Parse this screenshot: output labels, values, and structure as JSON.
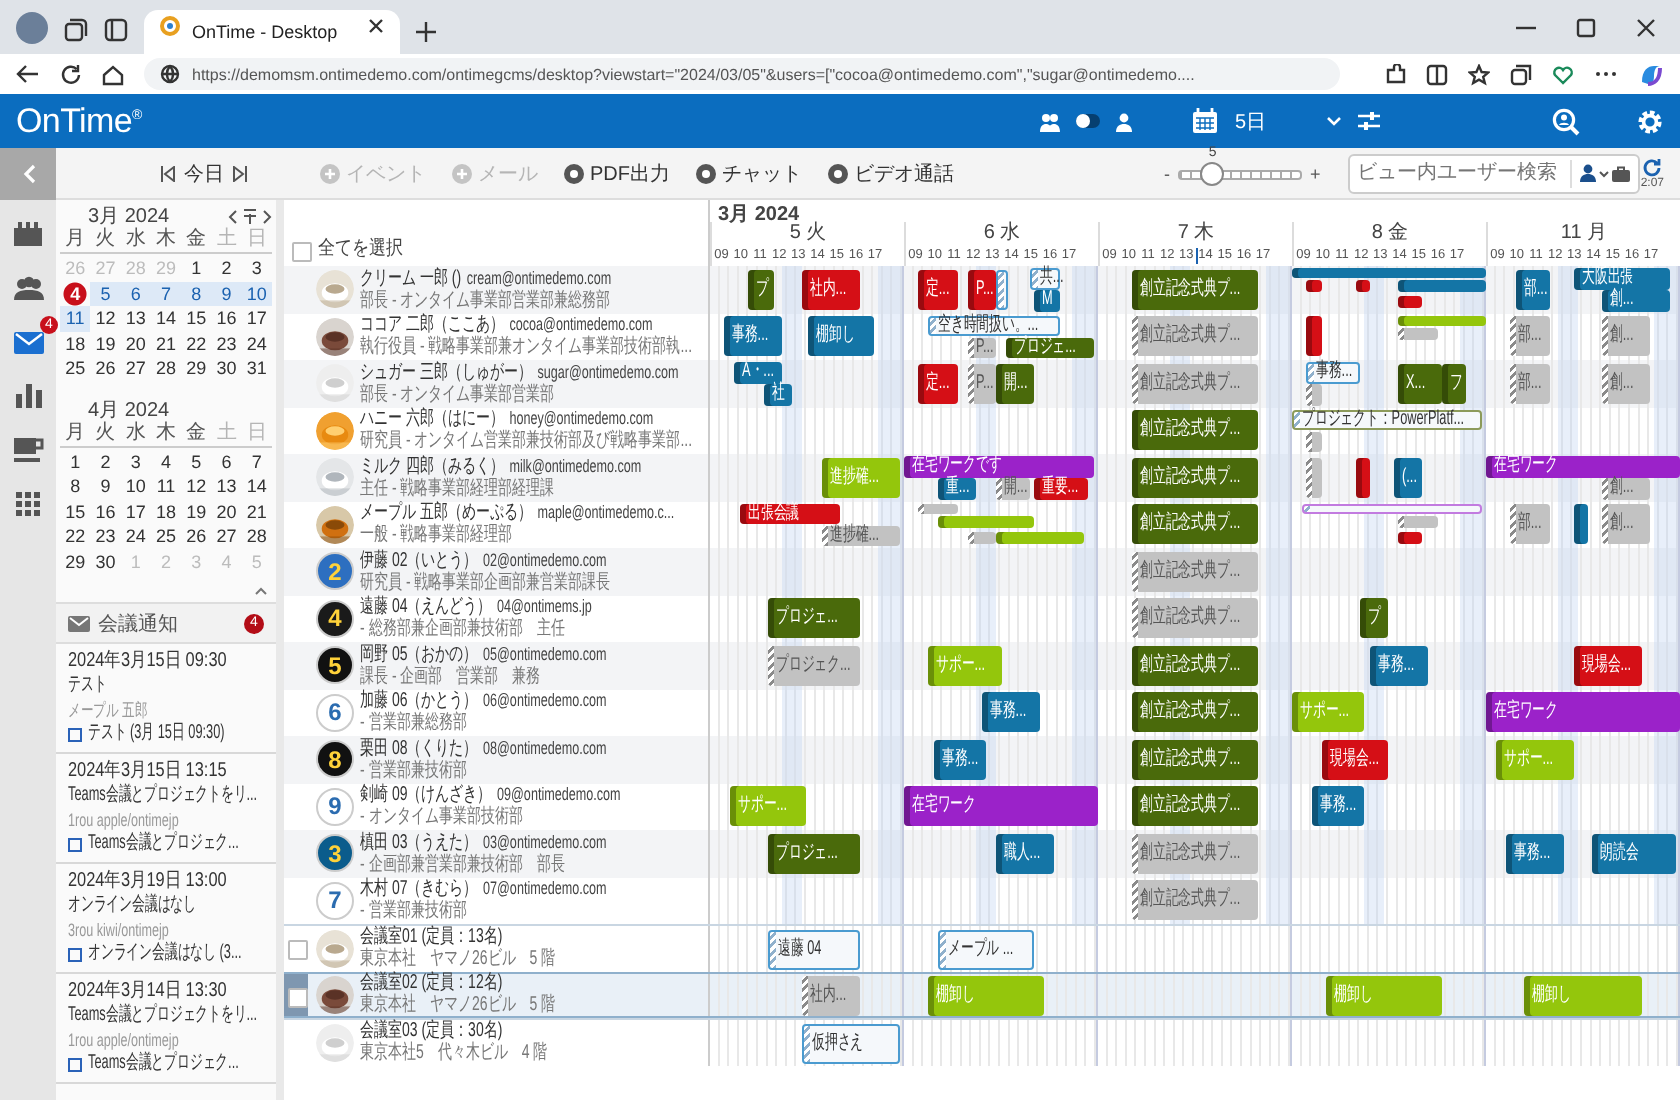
{
  "browser": {
    "tab_title": "OnTime - Desktop",
    "url": "https://demomsm.ontimedemo.com/ontimegcms/desktop?viewstart=\"2024/03/05\"&users=[\"cocoa@ontimedemo.com\",\"sugar@ontimedemo...."
  },
  "app": {
    "logo": "OnTime$^{®}$",
    "team_toggle": {
      "on": false
    },
    "days": "5日"
  },
  "toolbar": {
    "today": "今日",
    "actions": [
      {
        "label": "イベント",
        "kind": "plus",
        "disabled": true
      },
      {
        "label": "メール",
        "kind": "plus",
        "disabled": true
      },
      {
        "label": "PDF出力",
        "kind": "dot",
        "disabled": false
      },
      {
        "label": "チャット",
        "kind": "dot",
        "disabled": false
      },
      {
        "label": "ビデオ通話",
        "kind": "dot",
        "disabled": false
      }
    ],
    "zoom": {
      "value": "5",
      "minus": "-",
      "plus": "+",
      "level": 0.28
    },
    "search": {
      "placeholder": "ビュー内ユーザー検索"
    },
    "refresh_time": "2:07"
  },
  "rail": [
    {
      "kind": "calendar",
      "selected": false
    },
    {
      "kind": "people",
      "selected": false
    },
    {
      "kind": "mail",
      "selected": true,
      "badge": "4"
    },
    {
      "kind": "chart",
      "selected": false
    },
    {
      "kind": "cup",
      "selected": false
    },
    {
      "kind": "grid",
      "selected": false
    }
  ],
  "mini_calendars": [
    {
      "title": "3月 2024",
      "weekdays": [
        {
          "label": "月",
          "weekend": false
        },
        {
          "label": "火",
          "weekend": false
        },
        {
          "label": "水",
          "weekend": false
        },
        {
          "label": "木",
          "weekend": false
        },
        {
          "label": "金",
          "weekend": false
        },
        {
          "label": "土",
          "weekend": true
        },
        {
          "label": "日",
          "weekend": true
        }
      ],
      "days": [
        {
          "day": "26",
          "muted": true,
          "today": false,
          "selected": false
        },
        {
          "day": "27",
          "muted": true,
          "today": false,
          "selected": false
        },
        {
          "day": "28",
          "muted": true,
          "today": false,
          "selected": false
        },
        {
          "day": "29",
          "muted": true,
          "today": false,
          "selected": false
        },
        {
          "day": "1",
          "muted": false,
          "today": false,
          "selected": false
        },
        {
          "day": "2",
          "muted": false,
          "today": false,
          "selected": false
        },
        {
          "day": "3",
          "muted": false,
          "today": false,
          "selected": false
        },
        {
          "day": "4",
          "muted": false,
          "today": true,
          "selected": false
        },
        {
          "day": "5",
          "muted": false,
          "today": false,
          "selected": true
        },
        {
          "day": "6",
          "muted": false,
          "today": false,
          "selected": true
        },
        {
          "day": "7",
          "muted": false,
          "today": false,
          "selected": true
        },
        {
          "day": "8",
          "muted": false,
          "today": false,
          "selected": true
        },
        {
          "day": "9",
          "muted": false,
          "today": false,
          "selected": true
        },
        {
          "day": "10",
          "muted": false,
          "today": false,
          "selected": true
        },
        {
          "day": "11",
          "muted": false,
          "today": false,
          "selected": true
        },
        {
          "day": "12",
          "muted": false,
          "today": false,
          "selected": false
        },
        {
          "day": "13",
          "muted": false,
          "today": false,
          "selected": false
        },
        {
          "day": "14",
          "muted": false,
          "today": false,
          "selected": false
        },
        {
          "day": "15",
          "muted": false,
          "today": false,
          "selected": false
        },
        {
          "day": "16",
          "muted": false,
          "today": false,
          "selected": false
        },
        {
          "day": "17",
          "muted": false,
          "today": false,
          "selected": false
        },
        {
          "day": "18",
          "muted": false,
          "today": false,
          "selected": false
        },
        {
          "day": "19",
          "muted": false,
          "today": false,
          "selected": false
        },
        {
          "day": "20",
          "muted": false,
          "today": false,
          "selected": false
        },
        {
          "day": "21",
          "muted": false,
          "today": false,
          "selected": false
        },
        {
          "day": "22",
          "muted": false,
          "today": false,
          "selected": false
        },
        {
          "day": "23",
          "muted": false,
          "today": false,
          "selected": false
        },
        {
          "day": "24",
          "muted": false,
          "today": false,
          "selected": false
        },
        {
          "day": "25",
          "muted": false,
          "today": false,
          "selected": false
        },
        {
          "day": "26",
          "muted": false,
          "today": false,
          "selected": false
        },
        {
          "day": "27",
          "muted": false,
          "today": false,
          "selected": false
        },
        {
          "day": "28",
          "muted": false,
          "today": false,
          "selected": false
        },
        {
          "day": "29",
          "muted": false,
          "today": false,
          "selected": false
        },
        {
          "day": "30",
          "muted": false,
          "today": false,
          "selected": false
        },
        {
          "day": "31",
          "muted": false,
          "today": false,
          "selected": false
        }
      ]
    },
    {
      "title": "4月 2024",
      "weekdays": [
        {
          "label": "月",
          "weekend": false
        },
        {
          "label": "火",
          "weekend": false
        },
        {
          "label": "水",
          "weekend": false
        },
        {
          "label": "木",
          "weekend": false
        },
        {
          "label": "金",
          "weekend": false
        },
        {
          "label": "土",
          "weekend": true
        },
        {
          "label": "日",
          "weekend": true
        }
      ],
      "days": [
        {
          "day": "1",
          "muted": false,
          "today": false,
          "selected": false
        },
        {
          "day": "2",
          "muted": false,
          "today": false,
          "selected": false
        },
        {
          "day": "3",
          "muted": false,
          "today": false,
          "selected": false
        },
        {
          "day": "4",
          "muted": false,
          "today": false,
          "selected": false
        },
        {
          "day": "5",
          "muted": false,
          "today": false,
          "selected": false
        },
        {
          "day": "6",
          "muted": false,
          "today": false,
          "selected": false
        },
        {
          "day": "7",
          "muted": false,
          "today": false,
          "selected": false
        },
        {
          "day": "8",
          "muted": false,
          "today": false,
          "selected": false
        },
        {
          "day": "9",
          "muted": false,
          "today": false,
          "selected": false
        },
        {
          "day": "10",
          "muted": false,
          "today": false,
          "selected": false
        },
        {
          "day": "11",
          "muted": false,
          "today": false,
          "selected": false
        },
        {
          "day": "12",
          "muted": false,
          "today": false,
          "selected": false
        },
        {
          "day": "13",
          "muted": false,
          "today": false,
          "selected": false
        },
        {
          "day": "14",
          "muted": false,
          "today": false,
          "selected": false
        },
        {
          "day": "15",
          "muted": false,
          "today": false,
          "selected": false
        },
        {
          "day": "16",
          "muted": false,
          "today": false,
          "selected": false
        },
        {
          "day": "17",
          "muted": false,
          "today": false,
          "selected": false
        },
        {
          "day": "18",
          "muted": false,
          "today": false,
          "selected": false
        },
        {
          "day": "19",
          "muted": false,
          "today": false,
          "selected": false
        },
        {
          "day": "20",
          "muted": false,
          "today": false,
          "selected": false
        },
        {
          "day": "21",
          "muted": false,
          "today": false,
          "selected": false
        },
        {
          "day": "22",
          "muted": false,
          "today": false,
          "selected": false
        },
        {
          "day": "23",
          "muted": false,
          "today": false,
          "selected": false
        },
        {
          "day": "24",
          "muted": false,
          "today": false,
          "selected": false
        },
        {
          "day": "25",
          "muted": false,
          "today": false,
          "selected": false
        },
        {
          "day": "26",
          "muted": false,
          "today": false,
          "selected": false
        },
        {
          "day": "27",
          "muted": false,
          "today": false,
          "selected": false
        },
        {
          "day": "28",
          "muted": false,
          "today": false,
          "selected": false
        },
        {
          "day": "29",
          "muted": false,
          "today": false,
          "selected": false
        },
        {
          "day": "30",
          "muted": false,
          "today": false,
          "selected": false
        },
        {
          "day": "1",
          "muted": true,
          "today": false,
          "selected": false
        },
        {
          "day": "2",
          "muted": true,
          "today": false,
          "selected": false
        },
        {
          "day": "3",
          "muted": true,
          "today": false,
          "selected": false
        },
        {
          "day": "4",
          "muted": true,
          "today": false,
          "selected": false
        },
        {
          "day": "5",
          "muted": true,
          "today": false,
          "selected": false
        }
      ]
    }
  ],
  "notifications": {
    "title": "会議通知",
    "count": "4",
    "items": [
      {
        "when": "2024年3月15日 09:30",
        "subject": "テスト",
        "from": "メープル 五郎",
        "link": "テスト (3月 15日 09:30)"
      },
      {
        "when": "2024年3月15日 13:15",
        "subject": "Teams会議とプロジェクトをリ...",
        "from": "1rou apple/ontimejp",
        "link": "Teams会議とプロジェク..."
      },
      {
        "when": "2024年3月19日 13:00",
        "subject": "オンライン会議はなし",
        "from": "3rou kiwi/ontimejp",
        "link": "オンライン会議はなし (3..."
      },
      {
        "when": "2024年3月14日 13:30",
        "subject": "Teams会議とプロジェクトをリ...",
        "from": "1rou apple/ontimejp",
        "link": "Teams会議とプロジェク..."
      }
    ]
  },
  "users": {
    "select_all": "全てを選択",
    "select_all_checked": false
  },
  "timeline": {
    "month": "3月 2024",
    "days": [
      {
        "label": "5 火",
        "hours": [
          "09",
          "10",
          "11",
          "12",
          "13",
          "14",
          "15",
          "16",
          "17"
        ]
      },
      {
        "label": "6 水",
        "hours": [
          "09",
          "10",
          "11",
          "12",
          "13",
          "14",
          "15",
          "16",
          "17"
        ]
      },
      {
        "label": "7 木",
        "hours": [
          "09",
          "10",
          "11",
          "12",
          "13",
          "14",
          "15",
          "16",
          "17"
        ]
      },
      {
        "label": "8 金",
        "hours": [
          "09",
          "10",
          "11",
          "12",
          "13",
          "14",
          "15",
          "16",
          "17"
        ]
      },
      {
        "label": "11 月",
        "hours": [
          "09",
          "10",
          "11",
          "12",
          "13",
          "14",
          "15",
          "16",
          "17"
        ]
      }
    ]
  },
  "rows": [
    {
      "kind": "user",
      "selected": false,
      "name": "クリーム 一郎 ()",
      "email": "cream@ontimedemo.com",
      "title": "部長 - オンタイム事業部営業部兼総務部",
      "avatar": {
        "kind": "picture"
      },
      "events": [
        {
          "label": "プ",
          "kind": "solid",
          "color": "#4a6a0b"
        },
        {
          "label": "社内...",
          "kind": "solid",
          "color": "#d50f16"
        },
        {
          "label": "定...",
          "kind": "solid",
          "color": "#d50f16"
        },
        {
          "label": "P...",
          "kind": "solid",
          "color": "#d50f16"
        },
        {
          "kind": "outline",
          "color": "#4a9bd0"
        },
        {
          "label": "共...",
          "kind": "outline",
          "color": "#4a9bd0"
        },
        {
          "label": "M",
          "kind": "solid",
          "color": "#1475a6"
        },
        {
          "label": "創立記念式典プ...",
          "kind": "solid",
          "color": "#4a6a0b"
        },
        {
          "kind": "solid",
          "color": "#1475a6"
        },
        {
          "kind": "solid",
          "color": "#d50f16"
        },
        {
          "kind": "solid",
          "color": "#d50f16"
        },
        {
          "kind": "solid",
          "color": "#1475a6"
        },
        {
          "kind": "solid",
          "color": "#d50f16"
        },
        {
          "label": "部...",
          "kind": "solid",
          "color": "#1475a6"
        },
        {
          "label": "大阪出張",
          "kind": "solid",
          "color": "#1475a6"
        },
        {
          "label": "創...",
          "kind": "solid",
          "color": "#1475a6"
        }
      ]
    },
    {
      "kind": "user",
      "selected": false,
      "name": "ココア 二郎（ここあ）",
      "email": "cocoa@ontimedemo.com",
      "title": "執行役員 - 戦略事業部兼オンタイム事業部技術部執...",
      "avatar": {
        "kind": "picture"
      },
      "events": [
        {
          "label": "事務...",
          "kind": "solid",
          "color": "#1475a6"
        },
        {
          "label": "棚卸し",
          "kind": "solid",
          "color": "#1475a6"
        },
        {
          "label": "空き時間扱い。...",
          "kind": "outline",
          "color": "#4a9bd0"
        },
        {
          "label": "P...",
          "kind": "tentative",
          "color": "#c2c2c2"
        },
        {
          "label": "プロジェ...",
          "kind": "solid",
          "color": "#4a6a0b"
        },
        {
          "label": "創立記念式典プ...",
          "kind": "tentative",
          "color": "#c2c2c2"
        },
        {
          "kind": "solid",
          "color": "#d50f16"
        },
        {
          "kind": "solid",
          "color": "#94c60c"
        },
        {
          "kind": "tentative",
          "color": "#c2c2c2"
        },
        {
          "label": "部...",
          "kind": "tentative",
          "color": "#c2c2c2"
        },
        {
          "label": "創...",
          "kind": "tentative",
          "color": "#c2c2c2"
        }
      ]
    },
    {
      "kind": "user",
      "selected": false,
      "name": "シュガー 三郎（しゅがー）",
      "email": "sugar@ontimedemo.com",
      "title": "部長 - オンタイム事業部営業部",
      "avatar": {
        "kind": "picture"
      },
      "events": [
        {
          "label": "A・...",
          "kind": "solid",
          "color": "#1475a6"
        },
        {
          "label": "社",
          "kind": "solid",
          "color": "#1475a6"
        },
        {
          "label": "定...",
          "kind": "solid",
          "color": "#d50f16"
        },
        {
          "label": "P...",
          "kind": "tentative",
          "color": "#c2c2c2"
        },
        {
          "label": "開...",
          "kind": "solid",
          "color": "#4a6a0b"
        },
        {
          "label": "創立記念式典プ...",
          "kind": "tentative",
          "color": "#c2c2c2"
        },
        {
          "label": "事務...",
          "kind": "outline",
          "color": "#4a9bd0"
        },
        {
          "kind": "tentative",
          "color": "#c2c2c2"
        },
        {
          "label": "X...",
          "kind": "solid",
          "color": "#4a6a0b"
        },
        {
          "label": "フ",
          "kind": "solid",
          "color": "#4a6a0b"
        },
        {
          "label": "部...",
          "kind": "tentative",
          "color": "#c2c2c2"
        },
        {
          "label": "創...",
          "kind": "tentative",
          "color": "#c2c2c2"
        }
      ]
    },
    {
      "kind": "user",
      "selected": false,
      "name": "ハニー 六郎（はにー）",
      "email": "honey@ontimedemo.com",
      "title": "研究員 - オンタイム営業部兼技術部及び戦略事業部...",
      "avatar": {
        "kind": "picture"
      },
      "events": [
        {
          "label": "創立記念式典プ...",
          "kind": "solid",
          "color": "#4a6a0b"
        },
        {
          "label": "プロジェクト：PowerPlatf...",
          "kind": "outline",
          "color": "#8c9a5a"
        },
        {
          "kind": "tentative",
          "color": "#c2c2c2"
        }
      ]
    },
    {
      "kind": "user",
      "selected": false,
      "name": "ミルク 四郎（みるく）",
      "email": "milk@ontimedemo.com",
      "title": "主任 - 戦略事業部経理部経理課",
      "avatar": {
        "kind": "picture"
      },
      "events": [
        {
          "label": "進捗確...",
          "kind": "solid",
          "color": "#94c60c"
        },
        {
          "label": "在宅ワークです",
          "kind": "solid",
          "color": "#9b22c9"
        },
        {
          "label": "重...",
          "kind": "solid",
          "color": "#1475a6"
        },
        {
          "label": "開...",
          "kind": "tentative",
          "color": "#c2c2c2"
        },
        {
          "label": "重要...",
          "kind": "solid",
          "color": "#d50f16"
        },
        {
          "label": "創立記念式典プ...",
          "kind": "solid",
          "color": "#4a6a0b"
        },
        {
          "kind": "tentative",
          "color": "#c2c2c2"
        },
        {
          "kind": "solid",
          "color": "#d50f16"
        },
        {
          "label": "(...",
          "kind": "solid",
          "color": "#1475a6"
        },
        {
          "label": "在宅ワーク",
          "kind": "solid",
          "color": "#9b22c9"
        },
        {
          "label": "創...",
          "kind": "tentative",
          "color": "#c2c2c2"
        }
      ]
    },
    {
      "kind": "user",
      "selected": false,
      "name": "メープル 五郎（めーぷる）",
      "email": "maple@ontimedemo.c...",
      "title": "一般 - 戦略事業部経理部",
      "avatar": {
        "kind": "picture"
      },
      "events": [
        {
          "label": "出張会議",
          "kind": "solid",
          "color": "#d50f16"
        },
        {
          "label": "進捗確...",
          "kind": "tentative",
          "color": "#c2c2c2"
        },
        {
          "kind": "tentative",
          "color": "#c2c2c2"
        },
        {
          "kind": "solid",
          "color": "#94c60c"
        },
        {
          "kind": "tentative",
          "color": "#c2c2c2"
        },
        {
          "kind": "solid",
          "color": "#94c60c"
        },
        {
          "label": "創立記念式典プ...",
          "kind": "solid",
          "color": "#4a6a0b"
        },
        {
          "kind": "outline",
          "color": "#c27be0"
        },
        {
          "kind": "tentative",
          "color": "#c2c2c2"
        },
        {
          "kind": "solid",
          "color": "#d50f16"
        },
        {
          "label": "部...",
          "kind": "tentative",
          "color": "#c2c2c2"
        },
        {
          "kind": "solid",
          "color": "#1475a6"
        },
        {
          "label": "創...",
          "kind": "tentative",
          "color": "#c2c2c2"
        }
      ]
    },
    {
      "kind": "user",
      "selected": false,
      "name": "伊藤 02（いとう）",
      "email": "02@ontimedemo.com",
      "title": "研究員 - 戦略事業部企画部兼営業部課長",
      "avatar": {
        "kind": "number",
        "text": "2",
        "color": "#2d6fc0"
      },
      "events": [
        {
          "label": "創立記念式典プ...",
          "kind": "tentative",
          "color": "#c2c2c2"
        }
      ]
    },
    {
      "kind": "user",
      "selected": false,
      "name": "遠藤 04（えんどう）",
      "email": "04@ontimems.jp",
      "title": "- 総務部兼企画部兼技術部　主任",
      "avatar": {
        "kind": "number",
        "text": "4",
        "color": "#1a1a1a"
      },
      "events": [
        {
          "label": "プロジェ...",
          "kind": "solid",
          "color": "#4a6a0b"
        },
        {
          "label": "創立記念式典プ...",
          "kind": "tentative",
          "color": "#c2c2c2"
        },
        {
          "label": "プ",
          "kind": "solid",
          "color": "#4a6a0b"
        }
      ]
    },
    {
      "kind": "user",
      "selected": false,
      "name": "岡野 05（おかの）",
      "email": "05@ontimedemo.com",
      "title": "課長 - 企画部　営業部　兼務",
      "avatar": {
        "kind": "number",
        "text": "5",
        "color": "#111111"
      },
      "events": [
        {
          "label": "プロジェク...",
          "kind": "tentative",
          "color": "#c2c2c2"
        },
        {
          "label": "サポー...",
          "kind": "solid",
          "color": "#94c60c"
        },
        {
          "label": "創立記念式典プ...",
          "kind": "solid",
          "color": "#4a6a0b"
        },
        {
          "label": "事務...",
          "kind": "solid",
          "color": "#1475a6"
        },
        {
          "label": "現場会...",
          "kind": "solid",
          "color": "#d50f16"
        }
      ]
    },
    {
      "kind": "user",
      "selected": false,
      "name": "加藤 06（かとう）",
      "email": "06@ontimedemo.com",
      "title": "- 営業部兼総務部",
      "avatar": {
        "kind": "number",
        "text": "6",
        "color": "#ffffff"
      },
      "events": [
        {
          "label": "事務...",
          "kind": "solid",
          "color": "#1475a6"
        },
        {
          "label": "創立記念式典プ...",
          "kind": "solid",
          "color": "#4a6a0b"
        },
        {
          "label": "サポー...",
          "kind": "solid",
          "color": "#94c60c"
        },
        {
          "label": "在宅ワーク",
          "kind": "solid",
          "color": "#9b22c9"
        }
      ]
    },
    {
      "kind": "user",
      "selected": false,
      "name": "栗田 08（くりた）",
      "email": "08@ontimedemo.com",
      "title": "- 営業部兼技術部",
      "avatar": {
        "kind": "number",
        "text": "8",
        "color": "#111111"
      },
      "events": [
        {
          "label": "事務...",
          "kind": "solid",
          "color": "#1475a6"
        },
        {
          "label": "創立記念式典プ...",
          "kind": "solid",
          "color": "#4a6a0b"
        },
        {
          "label": "現場会...",
          "kind": "solid",
          "color": "#d50f16"
        },
        {
          "label": "サポー...",
          "kind": "solid",
          "color": "#94c60c"
        }
      ]
    },
    {
      "kind": "user",
      "selected": false,
      "name": "剣崎 09（けんざき）",
      "email": "09@ontimedemo.com",
      "title": "- オンタイム事業部技術部",
      "avatar": {
        "kind": "number",
        "text": "9",
        "color": "#ffffff"
      },
      "events": [
        {
          "label": "サポー...",
          "kind": "solid",
          "color": "#94c60c"
        },
        {
          "label": "在宅ワーク",
          "kind": "solid",
          "color": "#9b22c9"
        },
        {
          "label": "創立記念式典プ...",
          "kind": "solid",
          "color": "#4a6a0b"
        },
        {
          "label": "事務...",
          "kind": "solid",
          "color": "#1475a6"
        }
      ]
    },
    {
      "kind": "user",
      "selected": false,
      "name": "槙田 03（うえた）",
      "email": "03@ontimedemo.com",
      "title": "- 企画部兼営業部兼技術部　部長",
      "avatar": {
        "kind": "number",
        "text": "3",
        "color": "#0b5c8c"
      },
      "events": [
        {
          "label": "プロジェ...",
          "kind": "solid",
          "color": "#4a6a0b"
        },
        {
          "label": "職人...",
          "kind": "solid",
          "color": "#1475a6"
        },
        {
          "label": "創立記念式典プ...",
          "kind": "tentative",
          "color": "#c2c2c2"
        },
        {
          "label": "事務...",
          "kind": "solid",
          "color": "#1475a6"
        },
        {
          "label": "朗読会",
          "kind": "solid",
          "color": "#1475a6"
        }
      ]
    },
    {
      "kind": "user",
      "selected": false,
      "name": "木村 07（きむら）",
      "email": "07@ontimedemo.com",
      "title": "- 営業部兼技術部",
      "avatar": {
        "kind": "number",
        "text": "7",
        "color": "#ffffff"
      },
      "events": [
        {
          "label": "創立記念式典プ...",
          "kind": "tentative",
          "color": "#c2c2c2"
        }
      ]
    },
    {
      "kind": "room",
      "selected": false,
      "checked": false,
      "name": "会議室01 (定員：13名)",
      "title": "東京本社　ヤマノ26ビル　5 階",
      "avatar": {
        "kind": "picture"
      },
      "events": [
        {
          "label": "遠藤 04",
          "kind": "outline",
          "color": "#4a9bd0"
        },
        {
          "label": "メープル ...",
          "kind": "outline",
          "color": "#4a9bd0"
        }
      ]
    },
    {
      "kind": "room",
      "selected": true,
      "checked": false,
      "name": "会議室02 (定員：12名)",
      "title": "東京本社　ヤマノ26ビル　5 階",
      "avatar": {
        "kind": "picture"
      },
      "events": [
        {
          "label": "社内...",
          "kind": "tentative",
          "color": "#c2c2c2"
        },
        {
          "label": "棚卸し",
          "kind": "solid",
          "color": "#94c60c"
        },
        {
          "label": "棚卸し",
          "kind": "solid",
          "color": "#94c60c"
        },
        {
          "label": "棚卸し",
          "kind": "solid",
          "color": "#94c60c"
        }
      ]
    },
    {
      "kind": "room",
      "selected": false,
      "name": "会議室03 (定員：30名)",
      "title": "東京本社5　代々木ビル　4 階",
      "avatar": {
        "kind": "picture"
      },
      "events": [
        {
          "label": "仮押さえ",
          "kind": "outline",
          "color": "#4a9bd0"
        }
      ]
    }
  ]
}
